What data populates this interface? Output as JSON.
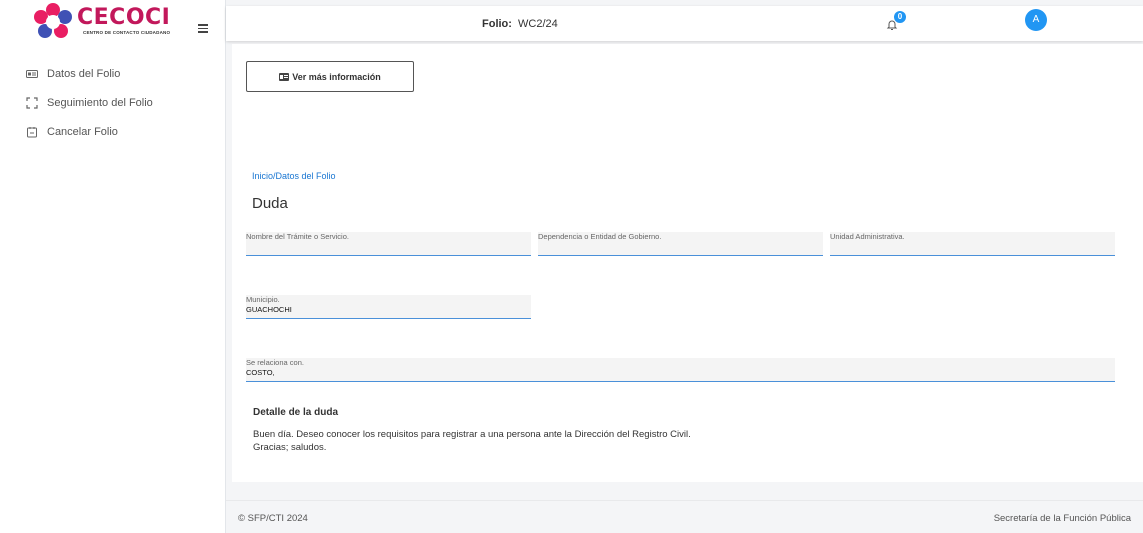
{
  "brand": {
    "name": "CECOCI",
    "subtitle": "CENTRO DE CONTACTO CIUDADANO"
  },
  "sidebar": {
    "items": [
      {
        "label": "Datos del Folio",
        "icon": "id-card-icon"
      },
      {
        "label": "Seguimiento del Folio",
        "icon": "expand-arrows-icon"
      },
      {
        "label": "Cancelar Folio",
        "icon": "calendar-cancel-icon"
      }
    ]
  },
  "topbar": {
    "folio_label": "Folio:",
    "folio_value": "WC2/24",
    "notifications_count": "0",
    "avatar_initial": "A"
  },
  "main": {
    "info_button": "Ver más información",
    "breadcrumb": "Inicio/Datos del Folio",
    "title": "Duda",
    "fields": {
      "tramite": {
        "label": "Nombre del Trámite o Servicio.",
        "value": ""
      },
      "dependencia": {
        "label": "Dependencia o Entidad de Gobierno.",
        "value": ""
      },
      "unidad": {
        "label": "Unidad Administrativa.",
        "value": ""
      },
      "municipio": {
        "label": "Municipio.",
        "value": "GUACHOCHI"
      },
      "relaciona": {
        "label": "Se relaciona con.",
        "value": "COSTO,"
      }
    },
    "detail_heading": "Detalle de la duda",
    "detail_text": "Buen día. Deseo conocer los requisitos para registrar a una persona ante la Dirección del Registro Civil. Gracias; saludos."
  },
  "footer": {
    "left": "© SFP/CTI 2024",
    "right": "Secretaría de la Función Pública"
  },
  "colors": {
    "accent": "#2196f3",
    "brand": "#c2185b",
    "link": "#1976d2"
  }
}
